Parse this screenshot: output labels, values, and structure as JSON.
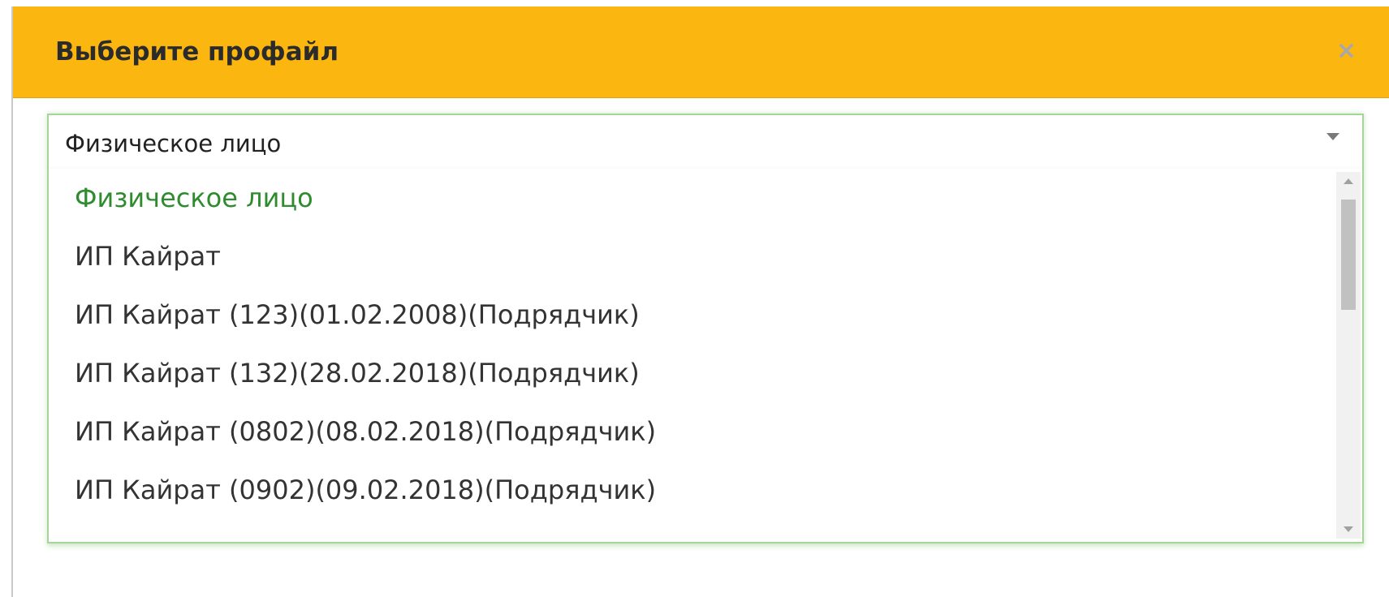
{
  "modal": {
    "title": "Выберите профайл",
    "close_label": "×",
    "header_color": "#fbb710"
  },
  "select": {
    "selected_value": "Физическое лицо",
    "border_color": "#a6d49a",
    "options": [
      {
        "label": "Физическое лицо",
        "selected": true
      },
      {
        "label": "ИП Кайрат",
        "selected": false
      },
      {
        "label": "ИП Кайрат (123)(01.02.2008)(Подрядчик)",
        "selected": false
      },
      {
        "label": "ИП Кайрат (132)(28.02.2018)(Подрядчик)",
        "selected": false
      },
      {
        "label": "ИП Кайрат (0802)(08.02.2018)(Подрядчик)",
        "selected": false
      },
      {
        "label": "ИП Кайрат (0902)(09.02.2018)(Подрядчик)",
        "selected": false
      }
    ],
    "selected_option_color": "#2e8b2e"
  }
}
